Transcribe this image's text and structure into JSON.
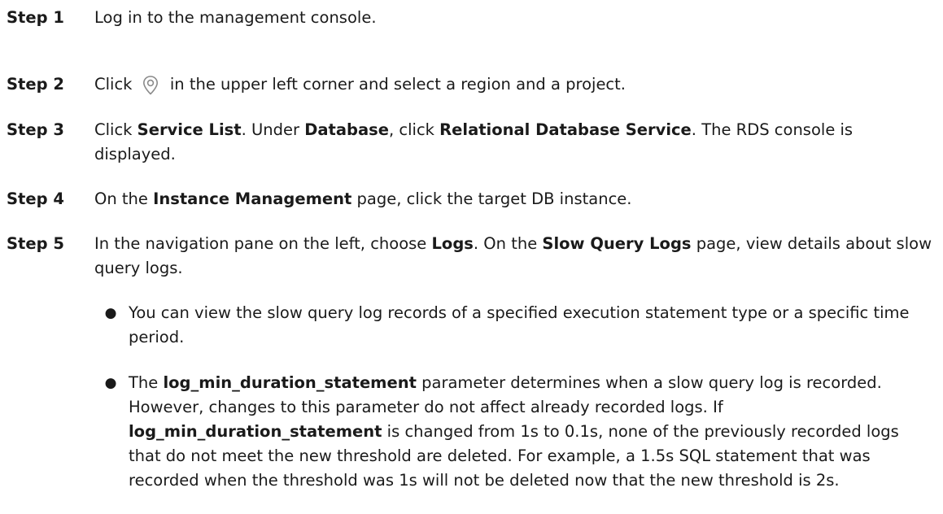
{
  "steps": [
    {
      "label": "Step 1",
      "parts": [
        {
          "t": "Log in to the management console.",
          "bold": false
        }
      ]
    },
    {
      "label": "Step 2",
      "before_icon": "Click ",
      "icon": "location-pin-icon",
      "after_icon": " in the upper left corner and select a region and a project."
    },
    {
      "label": "Step 3",
      "parts": [
        {
          "t": "Click ",
          "bold": false
        },
        {
          "t": "Service List",
          "bold": true
        },
        {
          "t": ". Under ",
          "bold": false
        },
        {
          "t": "Database",
          "bold": true
        },
        {
          "t": ", click ",
          "bold": false
        },
        {
          "t": "Relational Database Service",
          "bold": true
        },
        {
          "t": ". The RDS console is displayed.",
          "bold": false
        }
      ]
    },
    {
      "label": "Step 4",
      "parts": [
        {
          "t": "On the ",
          "bold": false
        },
        {
          "t": "Instance Management",
          "bold": true
        },
        {
          "t": " page, click the target DB instance.",
          "bold": false
        }
      ]
    },
    {
      "label": "Step 5",
      "parts": [
        {
          "t": "In the navigation pane on the left, choose ",
          "bold": false
        },
        {
          "t": "Logs",
          "bold": true
        },
        {
          "t": ". On the ",
          "bold": false
        },
        {
          "t": "Slow Query Logs",
          "bold": true
        },
        {
          "t": " page, view details about slow query logs.",
          "bold": false
        }
      ]
    }
  ],
  "bullets": [
    {
      "parts": [
        {
          "t": "You can view the slow query log records of a specified execution statement type or a specific time period.",
          "bold": false
        }
      ]
    },
    {
      "parts": [
        {
          "t": "The ",
          "bold": false
        },
        {
          "t": "log_min_duration_statement",
          "bold": true
        },
        {
          "t": " parameter determines when a slow query log is recorded. However, changes to this parameter do not affect already recorded logs. If ",
          "bold": false
        },
        {
          "t": "log_min_duration_statement",
          "bold": true
        },
        {
          "t": " is changed from 1s to 0.1s, none of the previously recorded logs that do not meet the new threshold are deleted. For example, a 1.5s SQL statement that was recorded when the threshold was 1s will not be deleted now that the new threshold is 2s.",
          "bold": false
        }
      ]
    }
  ],
  "bullet_glyph": "●"
}
